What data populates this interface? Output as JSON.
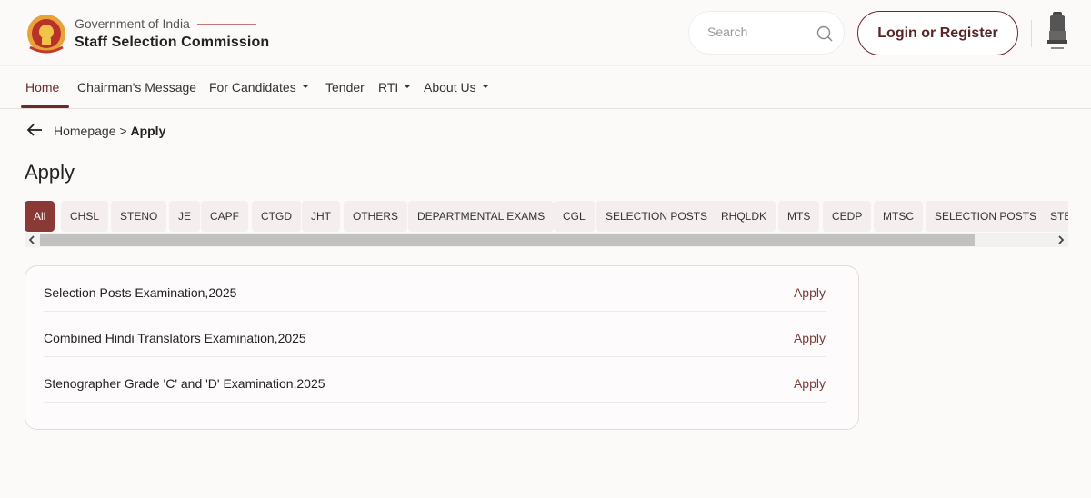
{
  "header": {
    "gov_label": "Government of India",
    "org_name": "Staff Selection Commission",
    "search_placeholder": "Search",
    "login_label": "Login or Register"
  },
  "nav": {
    "items": [
      {
        "label": "Home",
        "active": true
      },
      {
        "label": "Chairman's Message"
      },
      {
        "label": "For Candidates",
        "dropdown": true
      },
      {
        "label": "Tender"
      },
      {
        "label": "RTI",
        "dropdown": true
      },
      {
        "label": "About Us",
        "dropdown": true
      }
    ]
  },
  "breadcrumb": {
    "home": "Homepage",
    "separator": ">",
    "current": "Apply"
  },
  "page": {
    "title": "Apply"
  },
  "tabs": [
    "All",
    "CHSL",
    "STENO",
    "JE",
    "CAPF",
    "CTGD",
    "JHT",
    "OTHERS",
    "DEPARTMENTAL EXAMS",
    "CGL",
    "SELECTION POSTS",
    "RHQLDK",
    "MTS",
    "CEDP",
    "MTSC",
    "SELECTION POSTS",
    "STENO"
  ],
  "exams": [
    {
      "name": "Selection Posts Examination,2025",
      "action": "Apply"
    },
    {
      "name": "Combined Hindi Translators Examination,2025",
      "action": "Apply"
    },
    {
      "name": "Stenographer Grade 'C' and 'D' Examination,2025",
      "action": "Apply"
    }
  ],
  "colors": {
    "accent": "#6b2a2a",
    "active_tab": "#8a3a36",
    "background": "#fcf9f9"
  },
  "icons": [
    "ssc-logo-icon",
    "search-icon",
    "national-emblem-icon",
    "back-arrow-icon",
    "caret-down-icon",
    "scroll-left-icon",
    "scroll-right-icon"
  ]
}
